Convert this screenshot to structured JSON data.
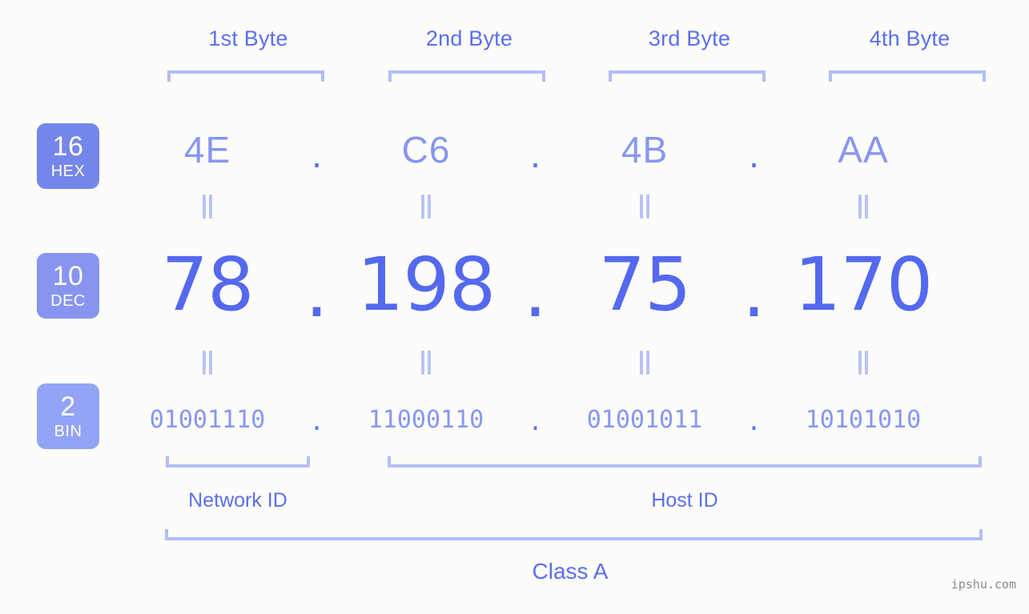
{
  "background_color": "#fcfdfa",
  "accent_color": "#5b6ef0",
  "accent_light": "#8796f2",
  "bracket_color": "#b4bdf7",
  "byte_headers": [
    {
      "label": "1st Byte"
    },
    {
      "label": "2nd Byte"
    },
    {
      "label": "3rd Byte"
    },
    {
      "label": "4th Byte"
    }
  ],
  "radix_badges": [
    {
      "number": "16",
      "name": "HEX",
      "color": "#7586ea"
    },
    {
      "number": "10",
      "name": "DEC",
      "color": "#8795f0"
    },
    {
      "number": "2",
      "name": "BIN",
      "color": "#93a3f5"
    }
  ],
  "rows": {
    "hex": {
      "values": [
        "4E",
        "C6",
        "4B",
        "AA"
      ],
      "separator": "."
    },
    "dec": {
      "values": [
        "78",
        "198",
        "75",
        "170"
      ],
      "separator": "."
    },
    "bin": {
      "values": [
        "01001110",
        "11000110",
        "01001011",
        "10101010"
      ],
      "separator": "."
    }
  },
  "equality_symbol": "=",
  "sections": [
    {
      "label": "Network ID"
    },
    {
      "label": "Host ID"
    }
  ],
  "class_label": "Class A",
  "watermark": "ipshu.com"
}
